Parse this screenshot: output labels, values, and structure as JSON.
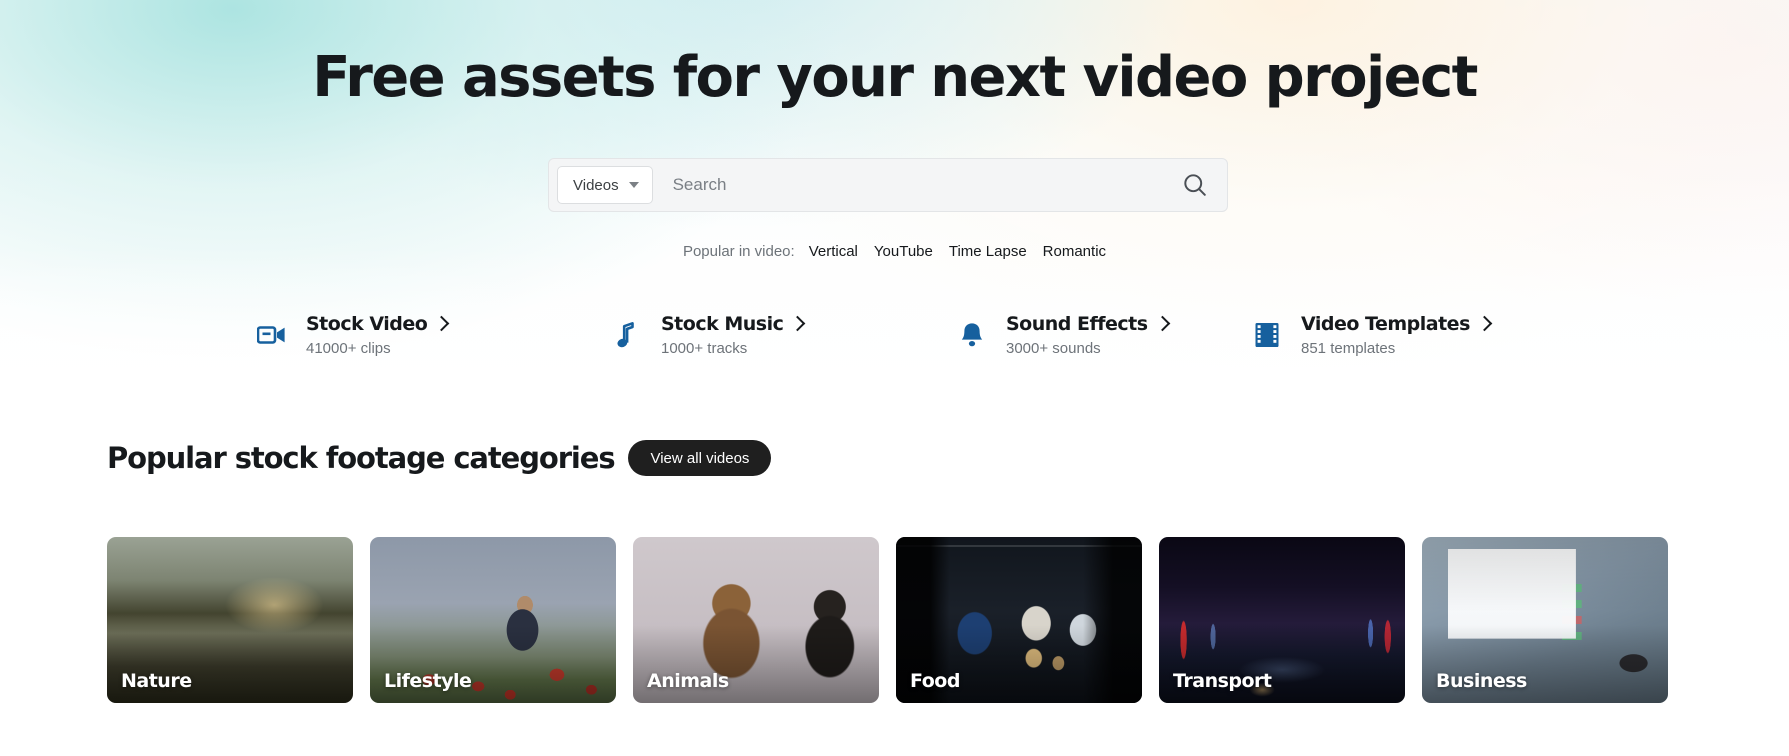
{
  "hero": {
    "title": "Free assets for your next video project"
  },
  "search": {
    "scope_label": "Videos",
    "scope_icon": "chevron-down-icon",
    "placeholder": "Search",
    "value": "",
    "submit_icon": "search-icon"
  },
  "popular": {
    "label": "Popular in video:",
    "tags": [
      {
        "label": "Vertical"
      },
      {
        "label": "YouTube"
      },
      {
        "label": "Time Lapse"
      },
      {
        "label": "Romantic"
      }
    ]
  },
  "stats": {
    "accent_color": "#16609e",
    "items": [
      {
        "title": "Stock Video",
        "count": "41000+ clips",
        "icon": "video-camera-icon"
      },
      {
        "title": "Stock Music",
        "count": "1000+ tracks",
        "icon": "music-note-icon"
      },
      {
        "title": "Sound Effects",
        "count": "3000+ sounds",
        "icon": "bell-icon"
      },
      {
        "title": "Video Templates",
        "count": "851 templates",
        "icon": "film-strip-icon"
      }
    ]
  },
  "categories": {
    "heading": "Popular stock footage categories",
    "view_all_label": "View all videos",
    "cards": [
      {
        "label": "Nature"
      },
      {
        "label": "Lifestyle"
      },
      {
        "label": "Animals"
      },
      {
        "label": "Food"
      },
      {
        "label": "Transport"
      },
      {
        "label": "Business"
      }
    ]
  }
}
